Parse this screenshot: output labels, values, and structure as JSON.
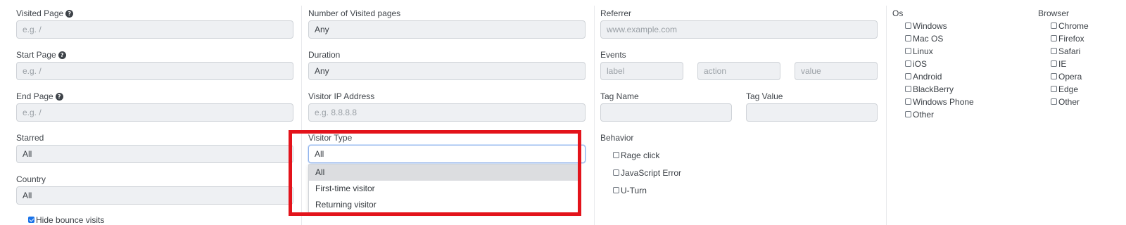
{
  "col1": {
    "visited_page": {
      "label": "Visited Page",
      "placeholder": "e.g. /"
    },
    "start_page": {
      "label": "Start Page",
      "placeholder": "e.g. /"
    },
    "end_page": {
      "label": "End Page",
      "placeholder": "e.g. /"
    },
    "starred": {
      "label": "Starred",
      "value": "All"
    },
    "country": {
      "label": "Country",
      "value": "All"
    },
    "hide_bounce": {
      "label": "Hide bounce visits",
      "checked": true
    }
  },
  "col2": {
    "num_visited_pages": {
      "label": "Number of Visited pages",
      "value": "Any"
    },
    "duration": {
      "label": "Duration",
      "value": "Any"
    },
    "visitor_ip": {
      "label": "Visitor IP Address",
      "placeholder": "e.g. 8.8.8.8"
    },
    "visitor_type": {
      "label": "Visitor Type",
      "value": "All",
      "options": [
        "All",
        "First-time visitor",
        "Returning visitor"
      ]
    }
  },
  "col3": {
    "referrer": {
      "label": "Referrer",
      "placeholder": "www.example.com"
    },
    "events": {
      "label": "Events",
      "placeholders": [
        "label",
        "action",
        "value"
      ]
    },
    "tag_name": {
      "label": "Tag Name",
      "value": ""
    },
    "tag_value": {
      "label": "Tag Value",
      "value": ""
    },
    "behavior": {
      "label": "Behavior",
      "options": [
        "Rage click",
        "JavaScript Error",
        "U-Turn"
      ]
    }
  },
  "col4": {
    "os": {
      "label": "Os",
      "options": [
        "Windows",
        "Mac OS",
        "Linux",
        "iOS",
        "Android",
        "BlackBerry",
        "Windows Phone",
        "Other"
      ]
    },
    "browser": {
      "label": "Browser",
      "options": [
        "Chrome",
        "Firefox",
        "Safari",
        "IE",
        "Opera",
        "Edge",
        "Other"
      ]
    }
  },
  "colors": {
    "annotation": "#e3131b",
    "checkbox_checked": "#1a73e8",
    "field_bg": "#eef0f3"
  }
}
